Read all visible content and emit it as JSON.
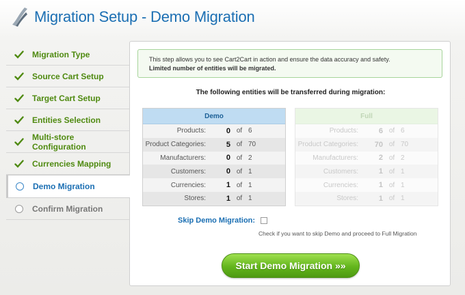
{
  "header": {
    "title": "Migration Setup - Demo Migration",
    "logo_icon": "cart2cart-logo"
  },
  "sidebar": {
    "items": [
      {
        "label": "Migration Type",
        "state": "done"
      },
      {
        "label": "Source Cart Setup",
        "state": "done"
      },
      {
        "label": "Target Cart Setup",
        "state": "done"
      },
      {
        "label": "Entities Selection",
        "state": "done"
      },
      {
        "label": "Multi-store Configuration",
        "state": "done"
      },
      {
        "label": "Currencies Mapping",
        "state": "done"
      },
      {
        "label": "Demo Migration",
        "state": "active"
      },
      {
        "label": "Confirm Migration",
        "state": "pending"
      }
    ]
  },
  "info": {
    "line1": "This step allows you to see Cart2Cart in action and ensure the data accuracy and safety.",
    "line2": "Limited number of entities will be migrated."
  },
  "entities_title": "The following entities will be transferred during migration:",
  "demo_table": {
    "header": "Demo",
    "of_label": "of",
    "rows": [
      {
        "name": "Products:",
        "value": "0",
        "total": "6"
      },
      {
        "name": "Product Categories:",
        "value": "5",
        "total": "70"
      },
      {
        "name": "Manufacturers:",
        "value": "0",
        "total": "2"
      },
      {
        "name": "Customers:",
        "value": "0",
        "total": "1"
      },
      {
        "name": "Currencies:",
        "value": "1",
        "total": "1"
      },
      {
        "name": "Stores:",
        "value": "1",
        "total": "1"
      }
    ]
  },
  "full_table": {
    "header": "Full",
    "of_label": "of",
    "rows": [
      {
        "name": "Products:",
        "value": "6",
        "total": "6"
      },
      {
        "name": "Product Categories:",
        "value": "70",
        "total": "70"
      },
      {
        "name": "Manufacturers:",
        "value": "2",
        "total": "2"
      },
      {
        "name": "Customers:",
        "value": "1",
        "total": "1"
      },
      {
        "name": "Currencies:",
        "value": "1",
        "total": "1"
      },
      {
        "name": "Stores:",
        "value": "1",
        "total": "1"
      }
    ]
  },
  "skip": {
    "label": "Skip Demo Migration:",
    "checked": false,
    "hint": "Check if you want to skip Demo and proceed to Full Migration"
  },
  "start_button": {
    "label": "Start Demo Migration »»"
  },
  "colors": {
    "accent_blue": "#1b6fb3",
    "step_green": "#4f8a10",
    "button_green": "#63b51c"
  }
}
